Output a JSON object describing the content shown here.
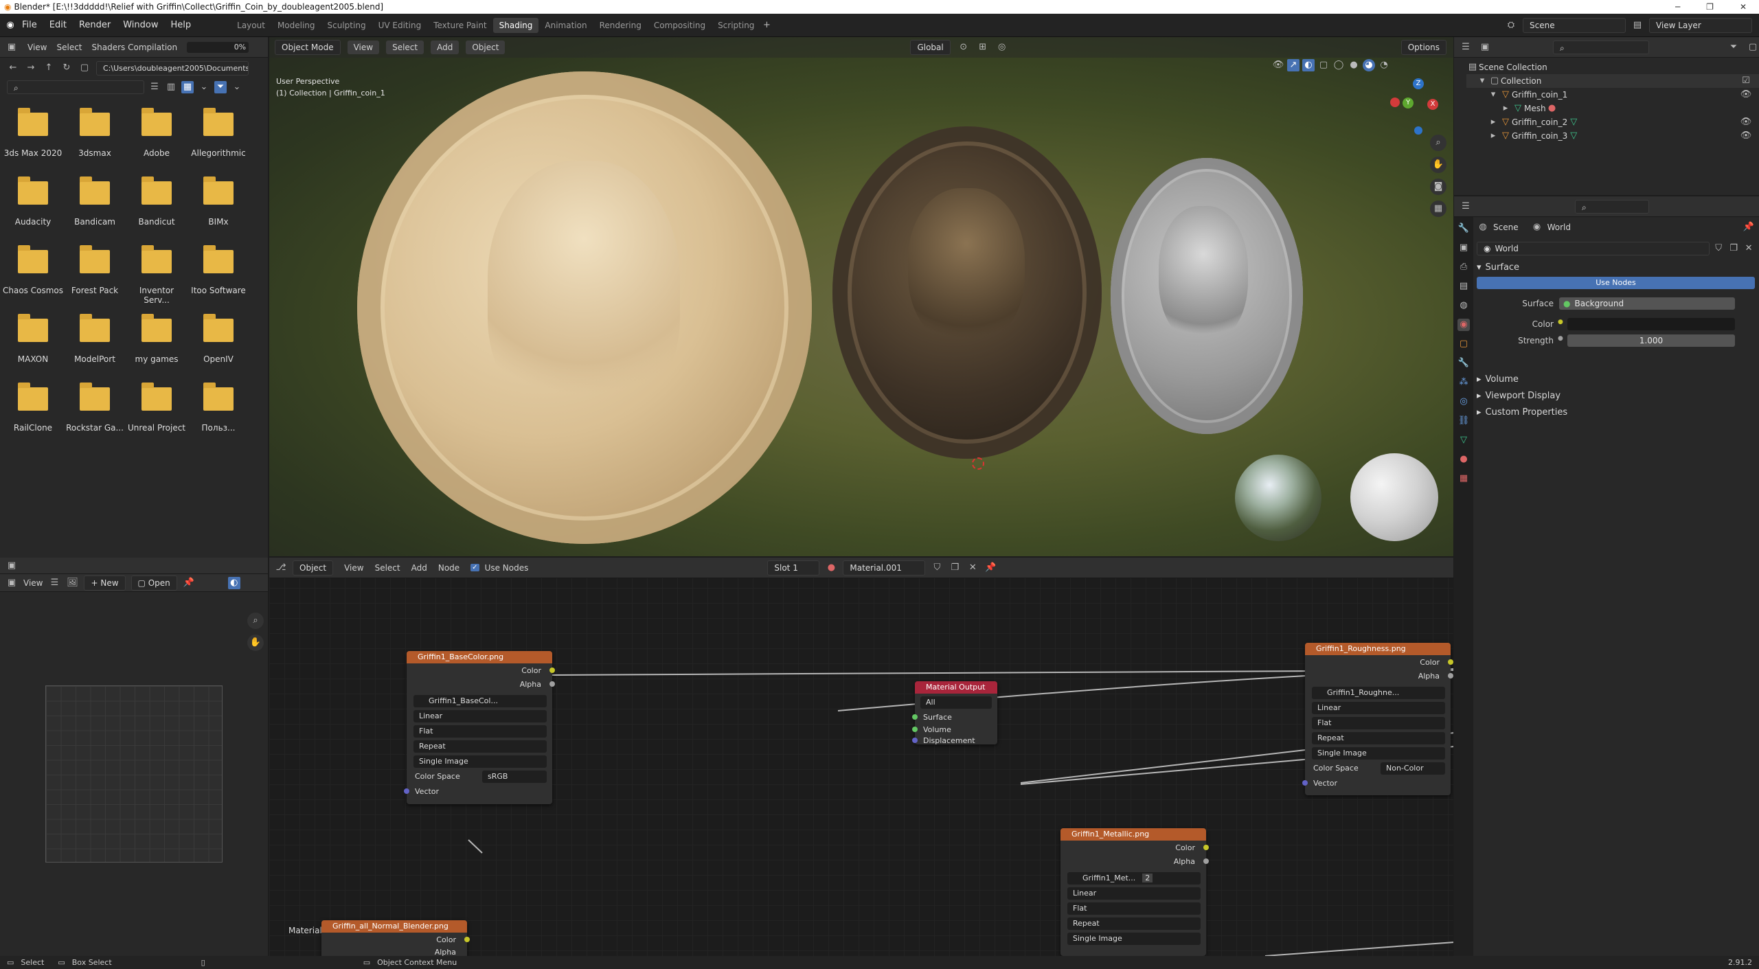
{
  "window": {
    "title": "Blender* [E:\\!!3ddddd!\\Relief with Griffin\\Collect\\Griffin_Coin_by_doubleagent2005.blend]"
  },
  "menu": [
    "File",
    "Edit",
    "Render",
    "Window",
    "Help"
  ],
  "workspaces": [
    "Layout",
    "Modeling",
    "Sculpting",
    "UV Editing",
    "Texture Paint",
    "Shading",
    "Animation",
    "Rendering",
    "Compositing",
    "Scripting"
  ],
  "active_workspace": "Shading",
  "topright": {
    "scene": "Scene",
    "view_layer": "View Layer"
  },
  "file_browser": {
    "menu": [
      "View",
      "Select"
    ],
    "progress_label": "Shaders Compilation",
    "progress_value": "0%",
    "progress_fraction": 0.0,
    "path": "C:\\Users\\doubleagent2005\\Documents\\",
    "folders": [
      "3ds Max 2020",
      "3dsmax",
      "Adobe",
      "Allegorithmic",
      "Audacity",
      "Bandicam",
      "Bandicut",
      "BIMx",
      "Chaos Cosmos",
      "Forest Pack",
      "Inventor Serv...",
      "Itoo Software",
      "MAXON",
      "ModelPort",
      "my games",
      "OpenIV",
      "RailClone",
      "Rockstar Ga...",
      "Unreal Project",
      "Польз..."
    ]
  },
  "viewport": {
    "mode": "Object Mode",
    "menu": [
      "View",
      "Select",
      "Add",
      "Object"
    ],
    "transform": "Global",
    "options": "Options",
    "info_line1": "User Perspective",
    "info_line2": "(1) Collection | Griffin_coin_1",
    "gizmo_z": "Z",
    "gizmo_x": "X",
    "gizmo_y": "Y"
  },
  "outliner": {
    "root": "Scene Collection",
    "items": [
      "Collection",
      "Griffin_coin_1",
      "Mesh",
      "Griffin_coin_2",
      "Griffin_coin_3"
    ]
  },
  "properties": {
    "breadcrumb_scene": "Scene",
    "breadcrumb_world": "World",
    "world_name": "World",
    "surface_panel": "Surface",
    "use_nodes": "Use Nodes",
    "surface_label": "Surface",
    "surface_value": "Background",
    "color_label": "Color",
    "strength_label": "Strength",
    "strength_value": "1.000",
    "panels": [
      "Volume",
      "Viewport Display",
      "Custom Properties"
    ]
  },
  "node_editor": {
    "editor_type": "Object",
    "menu": [
      "View",
      "Select",
      "Add",
      "Node"
    ],
    "use_nodes": "Use Nodes",
    "slot": "Slot 1",
    "material": "Material.001",
    "frame_label": "Material.001",
    "nodes": {
      "basecolor": {
        "title": "Griffin1_BaseColor.png",
        "out_color": "Color",
        "out_alpha": "Alpha",
        "image": "Griffin1_BaseCol...",
        "interp": "Linear",
        "proj": "Flat",
        "ext": "Repeat",
        "src": "Single Image",
        "cs_label": "Color Space",
        "cs_value": "sRGB",
        "vector": "Vector"
      },
      "output": {
        "title": "Material Output",
        "target": "All",
        "surface": "Surface",
        "volume": "Volume",
        "displacement": "Displacement"
      },
      "roughness": {
        "title": "Griffin1_Roughness.png",
        "out_color": "Color",
        "out_alpha": "Alpha",
        "image": "Griffin1_Roughne...",
        "interp": "Linear",
        "proj": "Flat",
        "ext": "Repeat",
        "src": "Single Image",
        "cs_label": "Color Space",
        "cs_value": "Non-Color",
        "vector": "Vector"
      },
      "metallic": {
        "title": "Griffin1_Metallic.png",
        "out_color": "Color",
        "out_alpha": "Alpha",
        "image": "Griffin1_Met...",
        "users": "2",
        "interp": "Linear",
        "proj": "Flat",
        "ext": "Repeat",
        "src": "Single Image"
      },
      "normal": {
        "title": "Griffin_all_Normal_Blender.png",
        "out_color": "Color",
        "out_alpha": "Alpha"
      }
    }
  },
  "image_editor": {
    "view": "View",
    "new": "New",
    "open": "Open"
  },
  "status_bar": {
    "select": "Select",
    "box_select": "Box Select",
    "context_menu": "Object Context Menu",
    "version": "2.91.2"
  },
  "colors": {
    "accent_blue": "#4772b3",
    "header_orange": "#b45a2a",
    "header_red": "#a8253b",
    "socket_yellow": "#c7c729",
    "socket_green": "#63c763",
    "socket_purple": "#6363c7"
  }
}
